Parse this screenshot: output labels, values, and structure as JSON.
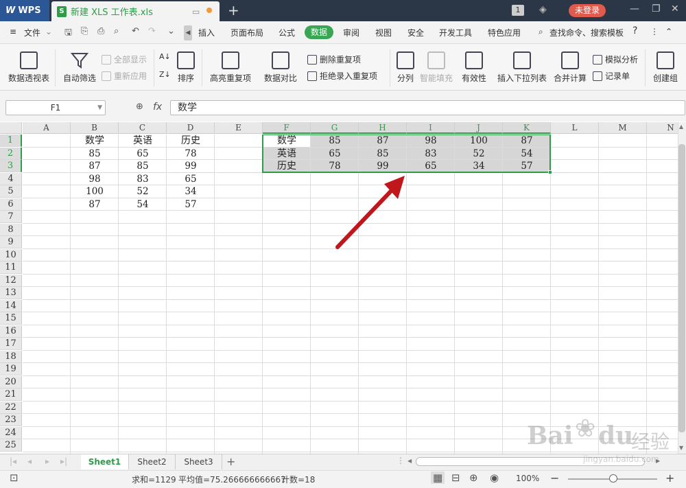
{
  "titlebar": {
    "app_name": "WPS",
    "doc_title": "新建 XLS 工作表.xls",
    "new_tab": "+",
    "badge_count": "1",
    "login": "未登录"
  },
  "menu": {
    "file": "文件",
    "items": [
      "插入",
      "页面布局",
      "公式",
      "数据",
      "审阅",
      "视图",
      "安全",
      "开发工具",
      "特色应用"
    ],
    "active": "数据",
    "search": "查找命令、搜索模板",
    "help": "?"
  },
  "ribbon": {
    "pivot": "数据透视表",
    "autofilter": "自动筛选",
    "show_all": "全部显示",
    "reapply": "重新应用",
    "sort": "排序",
    "highlight_dup": "高亮重复项",
    "compare": "数据对比",
    "delete_dup": "删除重复项",
    "reject_dup": "拒绝录入重复项",
    "split": "分列",
    "smart_fill": "智能填充",
    "validity": "有效性",
    "insert_dropdown": "插入下拉列表",
    "consolidate": "合并计算",
    "simulate": "模拟分析",
    "record": "记录单",
    "create_group": "创建组"
  },
  "formula_bar": {
    "name_box": "F1",
    "fx": "fx",
    "content": "数学"
  },
  "columns": [
    "A",
    "B",
    "C",
    "D",
    "E",
    "F",
    "G",
    "H",
    "I",
    "J",
    "K",
    "L",
    "M",
    "N"
  ],
  "rows": [
    "1",
    "2",
    "3",
    "4",
    "5",
    "6",
    "7",
    "8",
    "9",
    "10",
    "11",
    "12",
    "13",
    "14",
    "15",
    "16",
    "17",
    "18",
    "19",
    "20",
    "21",
    "22",
    "23",
    "24",
    "25"
  ],
  "source_table": {
    "headers": [
      "数学",
      "英语",
      "历史"
    ],
    "rows": [
      [
        "85",
        "65",
        "78"
      ],
      [
        "87",
        "85",
        "99"
      ],
      [
        "98",
        "83",
        "65"
      ],
      [
        "100",
        "52",
        "34"
      ],
      [
        "87",
        "54",
        "57"
      ]
    ]
  },
  "transposed_table": {
    "rows": [
      [
        "数学",
        "85",
        "87",
        "98",
        "100",
        "87"
      ],
      [
        "英语",
        "65",
        "85",
        "83",
        "52",
        "54"
      ],
      [
        "历史",
        "78",
        "99",
        "65",
        "34",
        "57"
      ]
    ]
  },
  "sheets": [
    "Sheet1",
    "Sheet2",
    "Sheet3"
  ],
  "active_sheet": "Sheet1",
  "status": {
    "sum": "求和=1129",
    "average": "平均值=75.266666666667",
    "count": "计数=18",
    "zoom": "100%",
    "minus": "−",
    "plus": "+"
  },
  "watermark": {
    "brand": "Bai",
    "brand2": "du",
    "cn": "经验",
    "url": "jingyan.baidu.com"
  },
  "colors": {
    "accent": "#2e9c48",
    "arrow": "#c0171d",
    "login": "#e05a4e",
    "titlebar": "#2b3746"
  }
}
